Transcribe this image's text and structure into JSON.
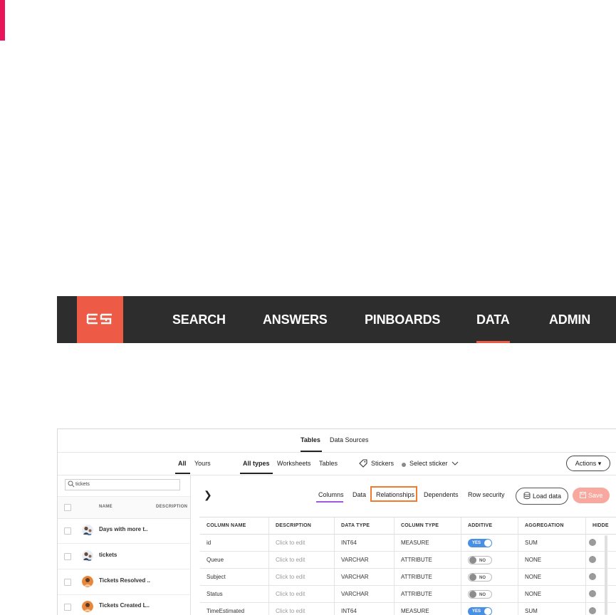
{
  "nav": {
    "items": [
      "SEARCH",
      "ANSWERS",
      "PINBOARDS",
      "DATA",
      "ADMIN"
    ],
    "active": "DATA"
  },
  "top_tabs": [
    "Tables",
    "Data Sources"
  ],
  "filters": {
    "owner": [
      "All",
      "Yours"
    ],
    "types": [
      "All types",
      "Worksheets",
      "Tables"
    ],
    "stickers_label": "Stickers",
    "select_sticker": "Select sticker",
    "actions_label": "Actions ▾"
  },
  "sidebar": {
    "search_value": "tickets",
    "col_name": "NAME",
    "col_description": "DESCRIPTION",
    "items": [
      {
        "name": "Days with more t..",
        "avatar": "group"
      },
      {
        "name": "tickets",
        "avatar": "group"
      },
      {
        "name": "Tickets Resolved ..",
        "avatar": "orange"
      },
      {
        "name": "Tickets Created L..",
        "avatar": "orange"
      }
    ]
  },
  "sub_tabs": [
    "Columns",
    "Data",
    "Relationships",
    "Dependents",
    "Row security"
  ],
  "active_sub_tab": "Columns",
  "highlighted_sub_tab": "Relationships",
  "buttons": {
    "load_data": "Load data",
    "save": "Save"
  },
  "table": {
    "headers": [
      "COLUMN NAME",
      "DESCRIPTION",
      "DATA TYPE",
      "COLUMN TYPE",
      "ADDITIVE",
      "AGGREGATION",
      "HIDDE"
    ],
    "rows": [
      {
        "name": "id",
        "description": "Click to edit",
        "data_type": "INT64",
        "column_type": "MEASURE",
        "additive": "YES",
        "aggregation": "SUM"
      },
      {
        "name": "Queue",
        "description": "Click to edit",
        "data_type": "VARCHAR",
        "column_type": "ATTRIBUTE",
        "additive": "NO",
        "aggregation": "NONE"
      },
      {
        "name": "Subject",
        "description": "Click to edit",
        "data_type": "VARCHAR",
        "column_type": "ATTRIBUTE",
        "additive": "NO",
        "aggregation": "NONE"
      },
      {
        "name": "Status",
        "description": "Click to edit",
        "data_type": "VARCHAR",
        "column_type": "ATTRIBUTE",
        "additive": "NO",
        "aggregation": "NONE"
      },
      {
        "name": "TimeEstimated",
        "description": "Click to edit",
        "data_type": "INT64",
        "column_type": "MEASURE",
        "additive": "YES",
        "aggregation": "SUM"
      }
    ]
  },
  "colors": {
    "accent": "#e8155b",
    "logo": "#ed5a45",
    "nav_bg": "#2d2d2d",
    "toggle_on": "#4a90e2",
    "highlight": "#f07b2c",
    "tab_underline": "#9b5ae0"
  }
}
